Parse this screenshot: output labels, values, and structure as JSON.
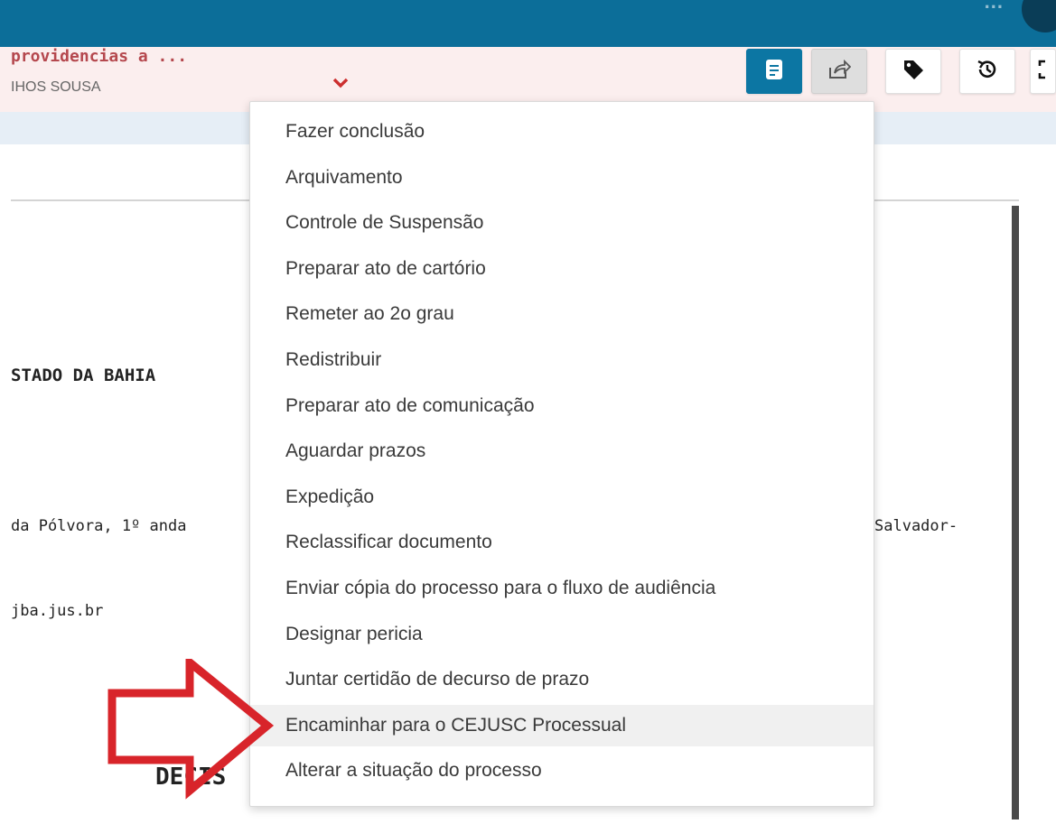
{
  "header": {
    "user_fragment": "...",
    "colors": {
      "bar": "#0c6e99",
      "task_bg": "#fbeeee",
      "task_title": "#b5484e"
    }
  },
  "task": {
    "title": "providencias a ...",
    "subtitle": "IHOS SOUSA",
    "chevron_icon": "chevron-down-icon"
  },
  "toolbar": {
    "buttons": [
      {
        "name": "document-button",
        "icon": "document-icon"
      },
      {
        "name": "share-button",
        "icon": "share-icon"
      },
      {
        "name": "tag-button",
        "icon": "tag-icon"
      },
      {
        "name": "history-button",
        "icon": "history-icon"
      },
      {
        "name": "expand-button",
        "icon": "expand-icon"
      }
    ]
  },
  "document": {
    "heading": "STADO DA BAHIA",
    "address_fragment": "da Pólvora, 1º anda",
    "email_fragment": "jba.jus.br",
    "right_fragment": "Salvador-",
    "decision_fragment": "DECIS"
  },
  "menu": {
    "items": [
      {
        "label": "Fazer conclusão"
      },
      {
        "label": "Arquivamento"
      },
      {
        "label": "Controle de Suspensão"
      },
      {
        "label": "Preparar ato de cartório"
      },
      {
        "label": "Remeter ao 2o grau"
      },
      {
        "label": "Redistribuir"
      },
      {
        "label": "Preparar ato de comunicação"
      },
      {
        "label": "Aguardar prazos"
      },
      {
        "label": "Expedição"
      },
      {
        "label": "Reclassificar documento"
      },
      {
        "label": "Enviar cópia do processo para o fluxo de audiência"
      },
      {
        "label": "Designar pericia"
      },
      {
        "label": "Juntar certidão de decurso de prazo"
      },
      {
        "label": "Encaminhar para o CEJUSC Processual",
        "highlighted": true
      },
      {
        "label": "Alterar a situação do processo"
      }
    ]
  },
  "annotation": {
    "arrow_color": "#d8242a",
    "arrow_icon": "red-arrow-icon"
  }
}
